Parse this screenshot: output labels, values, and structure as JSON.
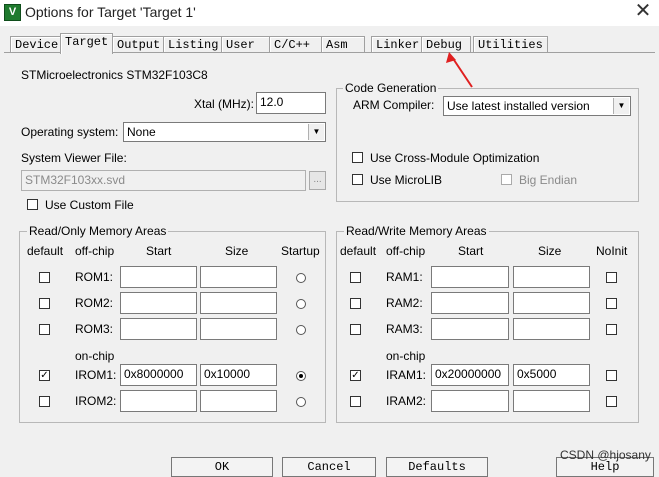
{
  "window": {
    "title": "Options for Target 'Target 1'",
    "icon": "keil-app-icon",
    "close_glyph": "✕"
  },
  "tabs": [
    "Device",
    "Target",
    "Output",
    "Listing",
    "User",
    "C/C++",
    "Asm",
    "Linker",
    "Debug",
    "Utilities"
  ],
  "active_tab": "Target",
  "device": {
    "name": "STMicroelectronics STM32F103C8"
  },
  "xtal": {
    "label": "Xtal (MHz):",
    "value": "12.0"
  },
  "os": {
    "label": "Operating system:",
    "value": "None"
  },
  "svd": {
    "label": "System Viewer File:",
    "value": "STM32F103xx.svd",
    "browse": "..."
  },
  "custom_file": {
    "label": "Use Custom File",
    "checked": false
  },
  "codegen": {
    "title": "Code Generation",
    "compiler_label": "ARM Compiler:",
    "compiler_value": "Use latest installed version",
    "cross_module": {
      "label": "Use Cross-Module Optimization",
      "checked": false
    },
    "microlib": {
      "label": "Use MicroLIB",
      "checked": false
    },
    "big_endian": {
      "label": "Big Endian",
      "checked": false,
      "disabled": true
    }
  },
  "rom": {
    "title": "Read/Only Memory Areas",
    "headers": {
      "default": "default",
      "offchip": "off-chip",
      "start": "Start",
      "size": "Size",
      "startup": "Startup"
    },
    "onchip_label": "on-chip",
    "rows": [
      {
        "name": "ROM1:",
        "default": false,
        "start": "",
        "size": "",
        "startup": false
      },
      {
        "name": "ROM2:",
        "default": false,
        "start": "",
        "size": "",
        "startup": false
      },
      {
        "name": "ROM3:",
        "default": false,
        "start": "",
        "size": "",
        "startup": false
      },
      {
        "name": "IROM1:",
        "default": true,
        "start": "0x8000000",
        "size": "0x10000",
        "startup": true
      },
      {
        "name": "IROM2:",
        "default": false,
        "start": "",
        "size": "",
        "startup": false
      }
    ]
  },
  "ram": {
    "title": "Read/Write Memory Areas",
    "headers": {
      "default": "default",
      "offchip": "off-chip",
      "start": "Start",
      "size": "Size",
      "noinit": "NoInit"
    },
    "onchip_label": "on-chip",
    "rows": [
      {
        "name": "RAM1:",
        "default": false,
        "start": "",
        "size": "",
        "noinit": false
      },
      {
        "name": "RAM2:",
        "default": false,
        "start": "",
        "size": "",
        "noinit": false
      },
      {
        "name": "RAM3:",
        "default": false,
        "start": "",
        "size": "",
        "noinit": false
      },
      {
        "name": "IRAM1:",
        "default": true,
        "start": "0x20000000",
        "size": "0x5000",
        "noinit": false
      },
      {
        "name": "IRAM2:",
        "default": false,
        "start": "",
        "size": "",
        "noinit": false
      }
    ]
  },
  "buttons": {
    "ok": "OK",
    "cancel": "Cancel",
    "defaults": "Defaults",
    "help": "Help"
  },
  "watermark": "CSDN @hjosany",
  "annotation_color": "#e02020"
}
